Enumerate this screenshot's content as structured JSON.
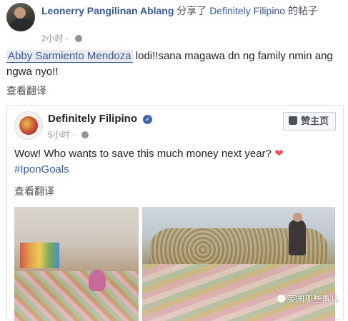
{
  "share_header": {
    "author": "Leonerry Pangilinan Ablang",
    "action": "分享了",
    "page": "Definitely Filipino",
    "suffix": "的帖子",
    "time": "2小时"
  },
  "comment": {
    "mention": "Abby Sarmiento Mendoza",
    "text": " lodi!!sana magawa dn ng family nmin ang ngwa nyo!!"
  },
  "translate_label": "查看翻译",
  "shared_post": {
    "page_name": "Definitely Filipino",
    "time": "5小时",
    "like_button": "赞主页",
    "text": "Wow! Who wants to save this much money next year?",
    "emoji": "❤",
    "hashtag": "#IponGoals",
    "translate_label": "查看翻译"
  },
  "watermark": "英国那些事儿",
  "icons": [
    "globe-icon",
    "verified-icon",
    "thumbs-up-icon",
    "heart-icon"
  ]
}
